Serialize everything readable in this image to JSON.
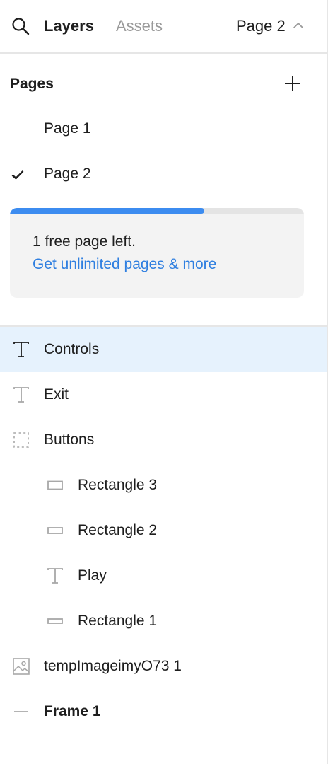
{
  "header": {
    "tabs": [
      {
        "label": "Layers",
        "active": true
      },
      {
        "label": "Assets",
        "active": false
      }
    ],
    "current_page": "Page 2",
    "icons": {
      "search": "search-icon",
      "page_toggle": "chevron-up-icon"
    }
  },
  "pages": {
    "title": "Pages",
    "add_icon": "plus-icon",
    "items": [
      {
        "label": "Page 1",
        "selected": false
      },
      {
        "label": "Page 2",
        "selected": true
      }
    ]
  },
  "upsell": {
    "progress_fraction": 0.66,
    "message": "1 free page left.",
    "link": "Get unlimited pages & more",
    "colors": {
      "progress": "#3c8cf0",
      "link": "#2f7fe0"
    }
  },
  "layers": [
    {
      "label": "Controls",
      "icon": "text-icon",
      "indent": 0,
      "selected": true
    },
    {
      "label": "Exit",
      "icon": "text-icon",
      "indent": 0
    },
    {
      "label": "Buttons",
      "icon": "group-dashed-icon",
      "indent": 0
    },
    {
      "label": "Rectangle 3",
      "icon": "rectangle-icon",
      "indent": 1
    },
    {
      "label": "Rectangle 2",
      "icon": "rectangle-icon",
      "indent": 1
    },
    {
      "label": "Play",
      "icon": "text-icon",
      "indent": 1
    },
    {
      "label": "Rectangle 1",
      "icon": "rectangle-icon",
      "indent": 1
    },
    {
      "label": "tempImageimyO73 1",
      "icon": "image-icon",
      "indent": 0
    },
    {
      "label": "Frame 1",
      "icon": "line-icon",
      "indent": 0,
      "bold": true
    }
  ],
  "colors": {
    "selection": "#e6f2fd",
    "divider": "#e6e6e6"
  }
}
